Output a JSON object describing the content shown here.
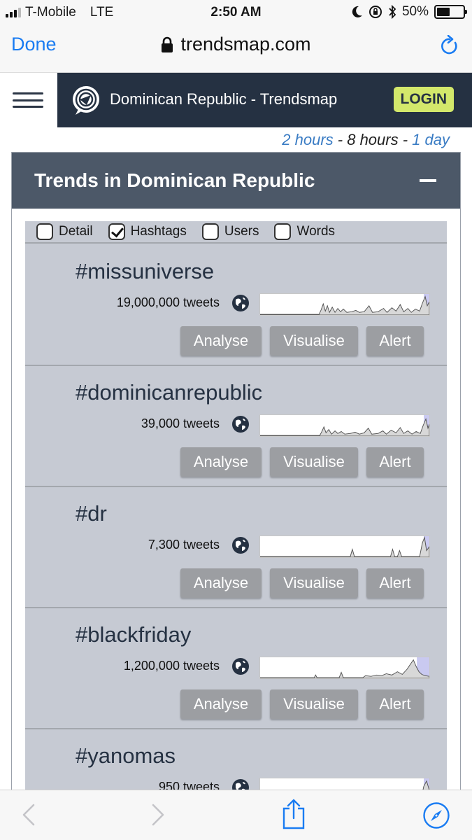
{
  "status_bar": {
    "carrier": "T-Mobile",
    "network": "LTE",
    "time": "2:50 AM",
    "battery": "50%",
    "battery_level": 0.5
  },
  "browser": {
    "done_label": "Done",
    "url": "trendsmap.com"
  },
  "site": {
    "title": "Dominican Republic - Trendsmap",
    "login_label": "LOGIN"
  },
  "time_filter": {
    "option_1": "2 hours",
    "sep_1": " - ",
    "option_2": "8 hours",
    "sep_2": " - ",
    "option_3": "1 day"
  },
  "panel": {
    "title": "Trends in Dominican Republic",
    "filters": [
      {
        "label": "Detail",
        "checked": false
      },
      {
        "label": "Hashtags",
        "checked": true
      },
      {
        "label": "Users",
        "checked": false
      },
      {
        "label": "Words",
        "checked": false
      }
    ]
  },
  "actions": {
    "analyse": "Analyse",
    "visualise": "Visualise",
    "alert": "Alert"
  },
  "trends": [
    {
      "name": "#missuniverse",
      "tweets": "19,000,000 tweets"
    },
    {
      "name": "#dominicanrepublic",
      "tweets": "39,000 tweets"
    },
    {
      "name": "#dr",
      "tweets": "7,300 tweets"
    },
    {
      "name": "#blackfriday",
      "tweets": "1,200,000 tweets"
    },
    {
      "name": "#yanomas",
      "tweets": "950 tweets"
    }
  ],
  "colors": {
    "header_dark": "#253142",
    "panel_header": "#4c5868",
    "login_accent": "#d3e86b",
    "link_blue": "#3a7cc4",
    "ios_blue": "#1a7cf2"
  }
}
